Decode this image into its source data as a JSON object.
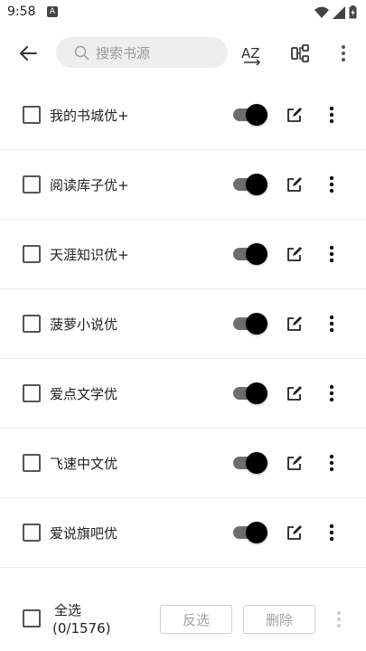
{
  "status_bar": {
    "time": "9:58",
    "notification_label": "A"
  },
  "toolbar": {
    "search_placeholder": "搜索书源",
    "sort_label": "AZ"
  },
  "sources": [
    {
      "name": "我的书城优+",
      "enabled": true
    },
    {
      "name": "阅读库子优+",
      "enabled": true
    },
    {
      "name": "天涯知识优+",
      "enabled": true
    },
    {
      "name": "菠萝小说优",
      "enabled": true
    },
    {
      "name": "爱点文学优",
      "enabled": true
    },
    {
      "name": "飞速中文优",
      "enabled": true
    },
    {
      "name": "爱说旗吧优",
      "enabled": true
    }
  ],
  "bottom_bar": {
    "select_all_label": "全选",
    "count": "(0/1576)",
    "invert_label": "反选",
    "delete_label": "删除"
  }
}
